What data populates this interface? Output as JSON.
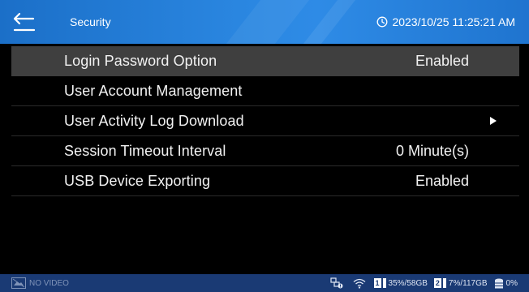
{
  "header": {
    "title": "Security",
    "datetime": "2023/10/25 11:25:21 AM"
  },
  "menu": {
    "items": [
      {
        "label": "Login Password Option",
        "value": "Enabled",
        "selected": true
      },
      {
        "label": "User Account Management",
        "value": ""
      },
      {
        "label": "User Activity Log Download",
        "value": "",
        "arrow": true
      },
      {
        "label": "Session Timeout Interval",
        "value": "0 Minute(s)"
      },
      {
        "label": "USB Device Exporting",
        "value": "Enabled"
      }
    ]
  },
  "statusbar": {
    "video_status": "NO VIDEO",
    "disk1": {
      "index": "1",
      "usage": "35%/58GB"
    },
    "disk2": {
      "index": "2",
      "usage": "7%/117GB"
    },
    "extra": {
      "usage": "0%"
    }
  },
  "colors": {
    "header": "#2a86e0",
    "selected_row": "#3f3f3f",
    "statusbar": "#1a3a74"
  }
}
